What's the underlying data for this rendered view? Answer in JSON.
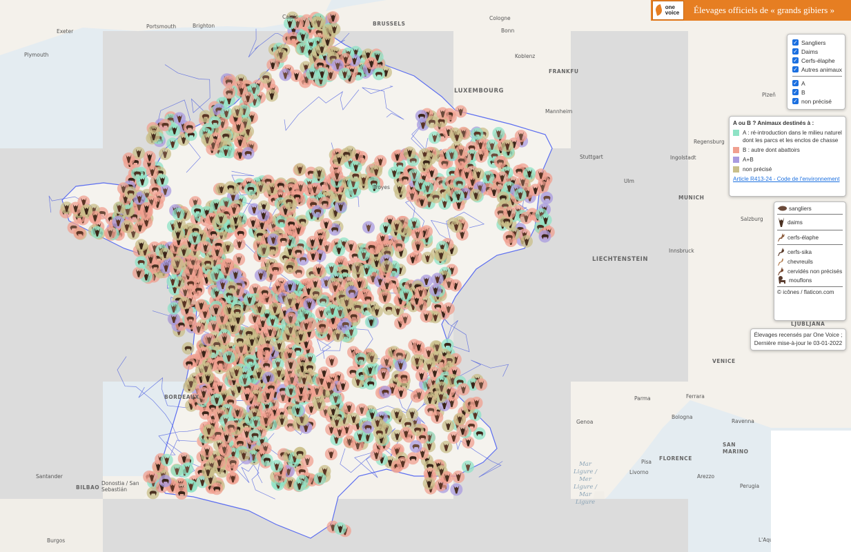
{
  "header": {
    "title": "Élevages officiels de « grands gibiers »",
    "logo_line1": "one",
    "logo_line2": "voice",
    "bg_color": "#e67e22"
  },
  "filters": {
    "animals": [
      {
        "label": "Sangliers",
        "checked": true
      },
      {
        "label": "Daims",
        "checked": true
      },
      {
        "label": "Cerfs-élaphe",
        "checked": true
      },
      {
        "label": "Autres animaux",
        "checked": true
      }
    ],
    "categories": [
      {
        "label": "A",
        "checked": true
      },
      {
        "label": "B",
        "checked": true
      },
      {
        "label": "non précisé",
        "checked": true
      }
    ]
  },
  "legend": {
    "heading": "A ou B ? Animaux destinés à :",
    "items": [
      {
        "label": "A : ré-introduction dans le milieu naturel dont les parcs et les enclos de chasse",
        "color": "#8fe3c6"
      },
      {
        "label": "B : autre dont abattoirs",
        "color": "#f0a090"
      },
      {
        "label": "A+B",
        "color": "#a99be0"
      },
      {
        "label": "non précisé",
        "color": "#c9bf8a"
      }
    ],
    "link": "Article R413-24 - Code de l'environnement"
  },
  "icon_legend": {
    "items": [
      "sangliers",
      "daims",
      "cerfs-élaphe",
      "cerfs-sika",
      "chevreuils",
      "cervidés non précisés",
      "mouflons"
    ],
    "credit": "© icônes / flaticon.com"
  },
  "note": {
    "line1": "Élevages recensés par One Voice ;",
    "line2": "Dernière mise-à-jour le 03-01-2022"
  },
  "cities": {
    "calais": "Calais",
    "portsmouth": "Portsmouth",
    "brighton": "Brighton",
    "exeter": "Exeter",
    "plymouth": "Plymouth",
    "brussels": "BRUSSELS",
    "cologne": "Cologne",
    "bonn": "Bonn",
    "koblenz": "Koblenz",
    "frankfurt": "FRANKFU",
    "luxembourg": "LUXEMBOURG",
    "mannheim": "Mannheim",
    "plzen": "Plzeň",
    "regensburg": "Regensburg",
    "stuttgart": "Stuttgart",
    "ingolstadt": "Ingolstadt",
    "ulm": "Ulm",
    "munich": "MUNICH",
    "salzburg": "Salzburg",
    "innsbruck": "Innsbruck",
    "liechtenstein": "LIECHTENSTEIN",
    "ljubljana": "LJUBLJANA",
    "venice": "VENICE",
    "ferrara": "Ferrara",
    "parma": "Parma",
    "bologna": "Bologna",
    "genoa": "Genoa",
    "ravenna": "Ravenna",
    "san_marino": "SAN MARINO",
    "florence": "FLORENCE",
    "pisa": "Pisa",
    "arezzo": "Arezzo",
    "livorno": "Livorno",
    "perugia": "Perugia",
    "laquila": "L'Aqu",
    "troyes": "Troyes",
    "bordeaux": "BORDEAUX",
    "santander": "Santander",
    "bilbao": "BILBAO",
    "donostia": "Donostia / San Sebastián",
    "burgos": "Burgos",
    "sea": "Mar Ligure / Mer Ligure / Mar Ligure"
  }
}
